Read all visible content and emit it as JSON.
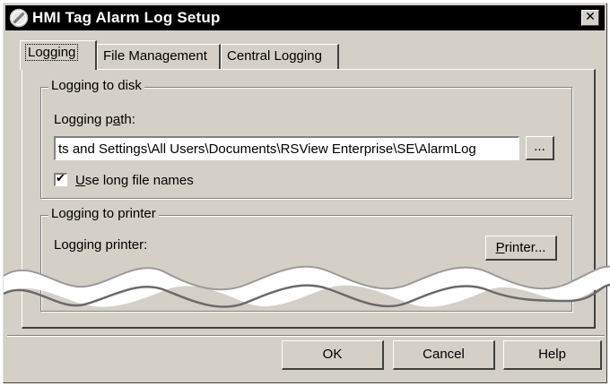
{
  "window": {
    "title": "HMI Tag Alarm Log Setup",
    "close_glyph": "✕",
    "icon": "no-entry-icon"
  },
  "tabs": [
    {
      "label": "Logging",
      "selected": true
    },
    {
      "label": "File Management",
      "selected": false
    },
    {
      "label": "Central Logging",
      "selected": false
    }
  ],
  "disk_group": {
    "title": "Logging to disk",
    "path_label_before": "Logging p",
    "path_label_access": "a",
    "path_label_after": "th:",
    "path_value": "ts and Settings\\All Users\\Documents\\RSView Enterprise\\SE\\AlarmLog",
    "browse_label": "...",
    "long_names_access": "U",
    "long_names_rest": "se long file names",
    "long_names_checked": true,
    "check_glyph": "✔"
  },
  "printer_group": {
    "title": "Logging to printer",
    "printer_label": "Logging printer:",
    "printer_btn_access": "P",
    "printer_btn_rest": "rinter..."
  },
  "footer": {
    "ok_label": "OK",
    "cancel_label": "Cancel",
    "help_label": "Help"
  }
}
